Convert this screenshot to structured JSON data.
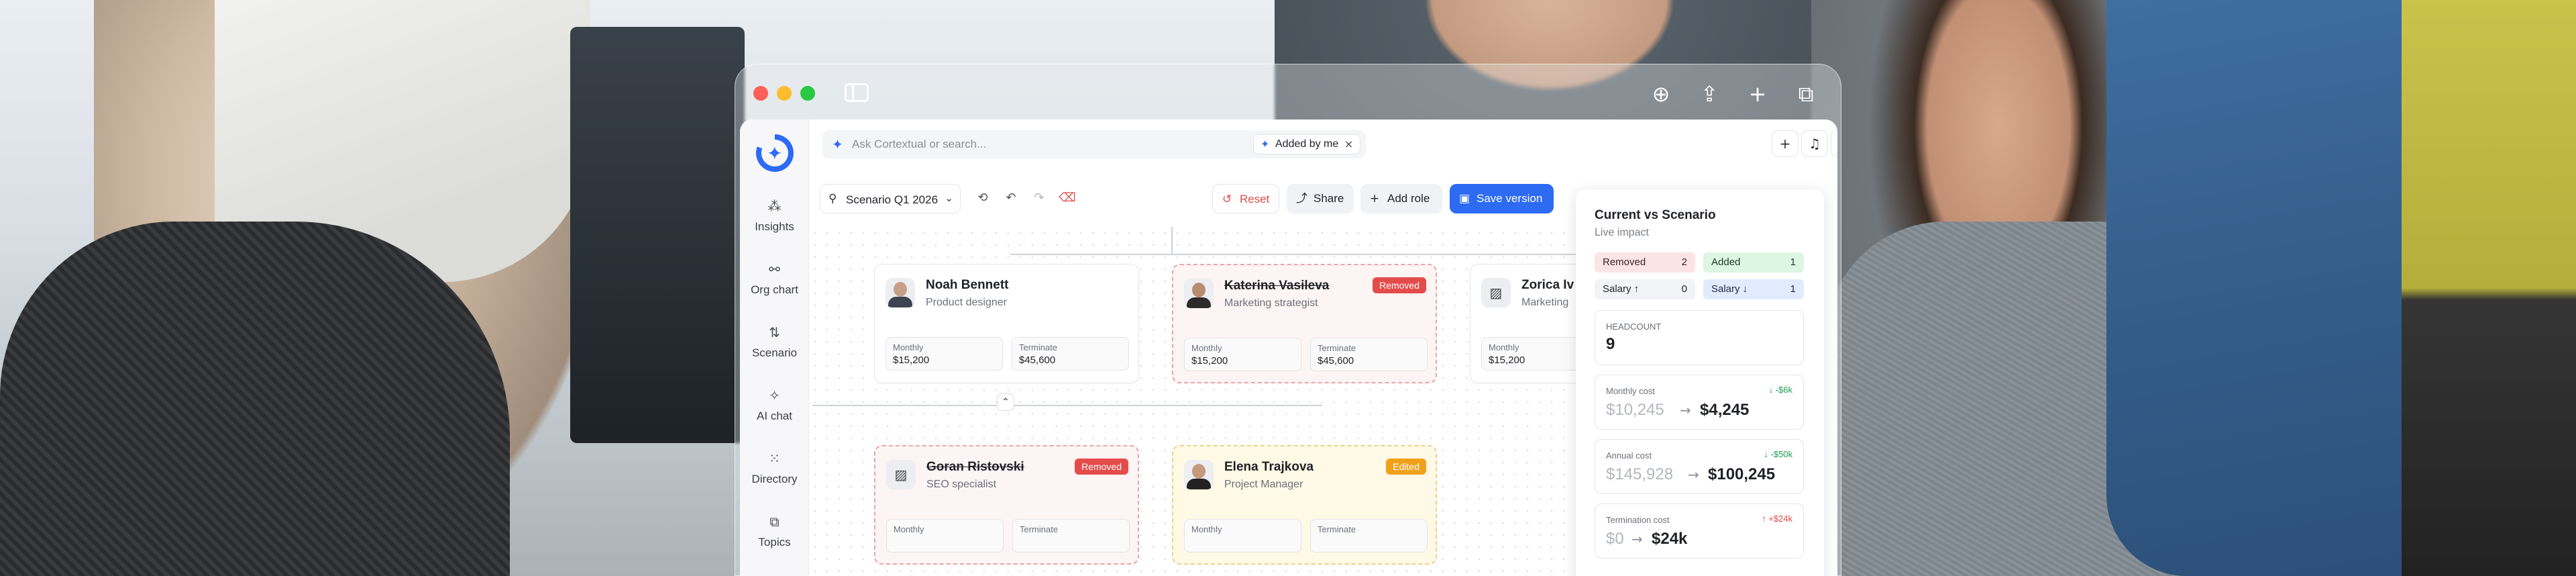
{
  "app": {
    "search": {
      "placeholder": "Ask Cortextual or search...",
      "filter_chip": "Added by me"
    },
    "nav": [
      {
        "label": "Insights",
        "icon": "insights-icon"
      },
      {
        "label": "Org chart",
        "icon": "org-chart-icon"
      },
      {
        "label": "Scenario",
        "icon": "scenario-icon"
      },
      {
        "label": "AI chat",
        "icon": "ai-chat-icon"
      },
      {
        "label": "Directory",
        "icon": "directory-icon"
      },
      {
        "label": "Topics",
        "icon": "topics-icon"
      }
    ],
    "toolbar": {
      "scenario": "Scenario Q1 2026",
      "reset": "Reset",
      "share": "Share",
      "add_role": "Add role",
      "save_version": "Save version"
    },
    "cards": [
      {
        "name": "Noah Bennett",
        "role": "Product designer",
        "status": "",
        "monthly_label": "Monthly",
        "monthly": "$15,200",
        "terminate_label": "Terminate",
        "terminate": "$45,600"
      },
      {
        "name": "Katerina Vasileva",
        "role": "Marketing strategist",
        "status": "Removed",
        "monthly_label": "Monthly",
        "monthly": "$15,200",
        "terminate_label": "Terminate",
        "terminate": "$45,600"
      },
      {
        "name": "Zorica Iv",
        "role": "Marketing",
        "status": "",
        "monthly_label": "Monthly",
        "monthly": "$15,200",
        "terminate_label": "",
        "terminate": ""
      },
      {
        "name": "Goran Ristovski",
        "role": "SEO specialist",
        "status": "Removed",
        "monthly_label": "Monthly",
        "monthly": "",
        "terminate_label": "Terminate",
        "terminate": ""
      },
      {
        "name": "Elena Trajkova",
        "role": "Project Manager",
        "status": "Edited",
        "monthly_label": "Monthly",
        "monthly": "",
        "terminate_label": "Terminate",
        "terminate": ""
      }
    ],
    "impact": {
      "title": "Current vs Scenario",
      "subtitle": "Live impact",
      "removed_label": "Removed",
      "removed_count": "2",
      "added_label": "Added",
      "added_count": "1",
      "salary_up_label": "Salary ↑",
      "salary_up_count": "0",
      "salary_down_label": "Salary ↓",
      "salary_down_count": "1",
      "headcount_label": "HEADCOUNT",
      "headcount_value": "9",
      "monthly_label": "Monthly cost",
      "monthly_old": "$10,245",
      "monthly_new": "$4,245",
      "monthly_delta": "↓ -$6k",
      "annual_label": "Annual cost",
      "annual_old": "$145,928",
      "annual_new": "$100,245",
      "annual_delta": "↓ -$50k",
      "termination_label": "Termination cost",
      "termination_old": "$0",
      "termination_new": "$24k",
      "termination_delta": "↑ +$24k"
    },
    "colors": {
      "accent": "#2c6bf2",
      "removed": "#e44c4c",
      "edited": "#f0a11c"
    }
  }
}
